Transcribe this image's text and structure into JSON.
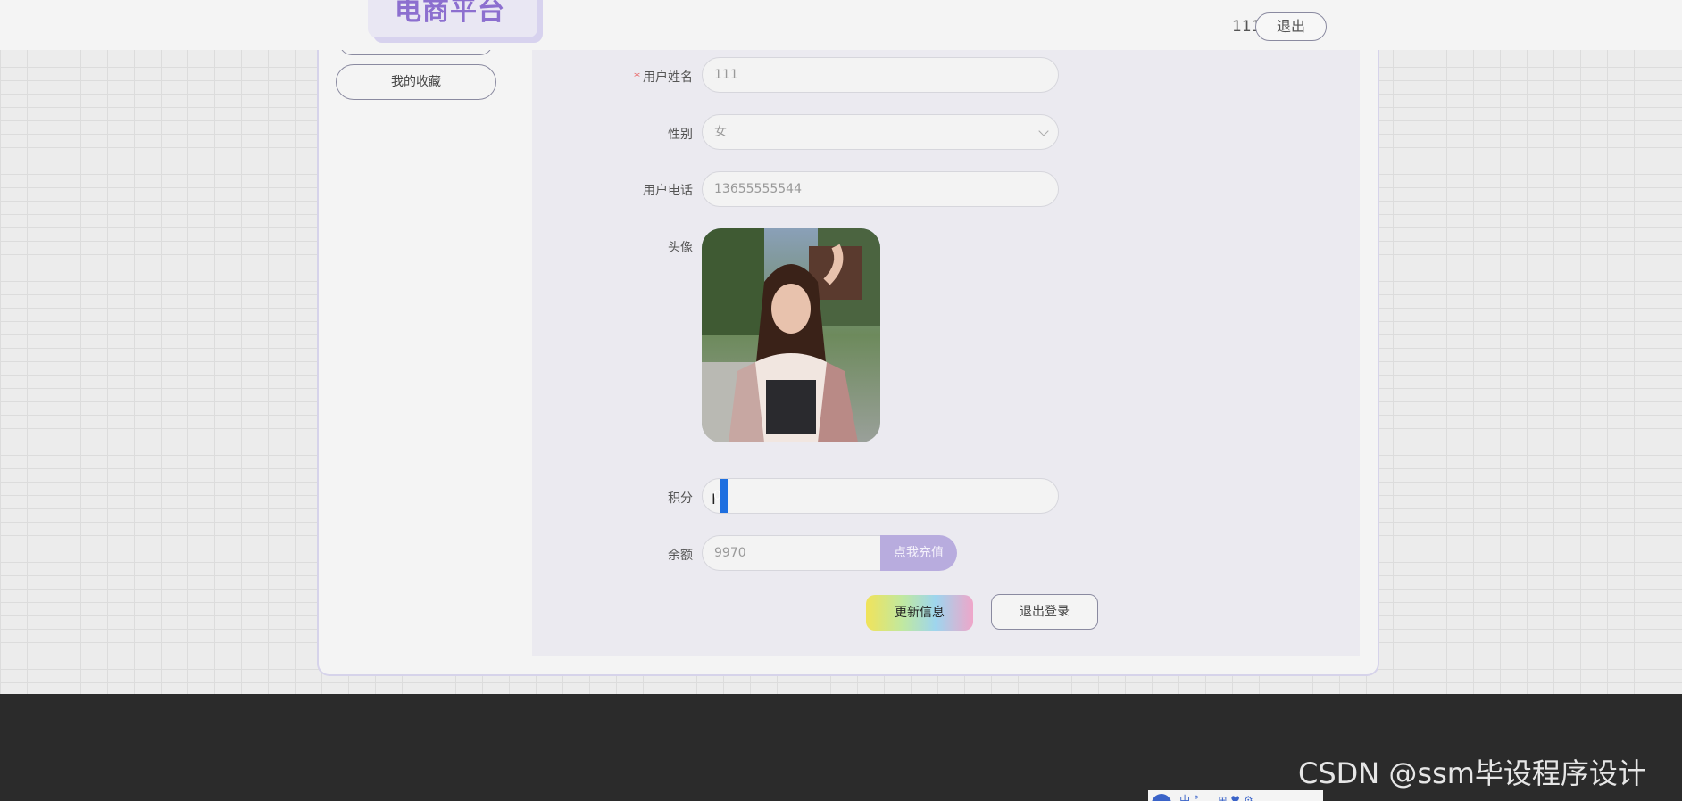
{
  "header": {
    "logo_text": "电商平台",
    "user_name": "111",
    "logout_label": "退出"
  },
  "sidebar": {
    "favorites_label": "我的收藏"
  },
  "form": {
    "username_label": "用户姓名",
    "username_required_mark": "*",
    "username_value": "111",
    "gender_label": "性别",
    "gender_value": "女",
    "phone_label": "用户电话",
    "phone_value": "13655555544",
    "avatar_label": "头像",
    "points_label": "积分",
    "points_value": "0",
    "balance_label": "余额",
    "balance_value": "9970",
    "recharge_label": "点我充值",
    "update_label": "更新信息",
    "logout_label": "退出登录"
  },
  "watermark": "CSDN @ssm毕设程序设计",
  "ime": {
    "logo": "五",
    "glyphs": "中 °, ⌄ ⊞ ♥ ⚙"
  },
  "colors": {
    "accent": "#8c6fcf",
    "recharge_bg": "#b8acde",
    "footer_bg": "#2b2b2b",
    "required": "#e86060"
  }
}
